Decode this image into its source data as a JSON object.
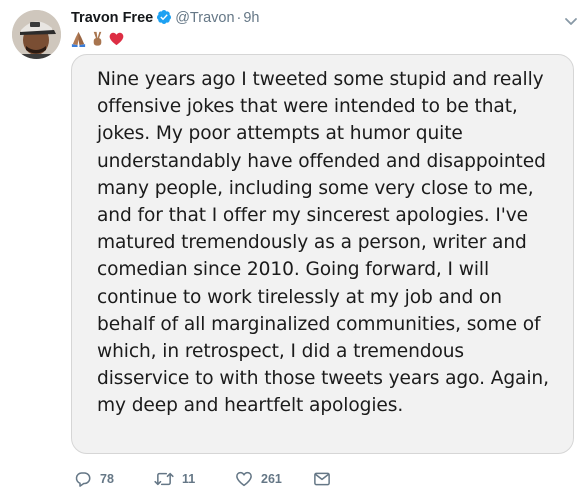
{
  "tweet": {
    "author_name": "Travon Free",
    "handle": "@Travon",
    "separator": "·",
    "time": "9h",
    "bio_emojis": [
      "folded-hands-emoji",
      "victory-hand-emoji",
      "red-heart-emoji"
    ],
    "note_lines": [
      "Nine years ago I tweeted some stupid and really",
      "offensive jokes that were intended to be that,",
      "jokes. My poor attempts at humor quite",
      "understandably have offended and disappointed",
      "many people, including some very close to me,",
      "and for that I offer my sincerest apologies. I've",
      "matured tremendously as a person, writer and",
      "comedian since 2010. Going forward, I will",
      "continue to work tirelessly at my job and on",
      "behalf of all marginalized communities, some of",
      "which, in retrospect, I did a tremendous",
      "disservice to with those tweets years ago. Again,",
      "my deep and heartfelt apologies."
    ],
    "reply_count": "78",
    "retweet_count": "11",
    "like_count": "261"
  },
  "colors": {
    "name": "#14171a",
    "muted": "#657786",
    "verified": "#1da1f2",
    "note_bg": "#f2f2f2"
  }
}
